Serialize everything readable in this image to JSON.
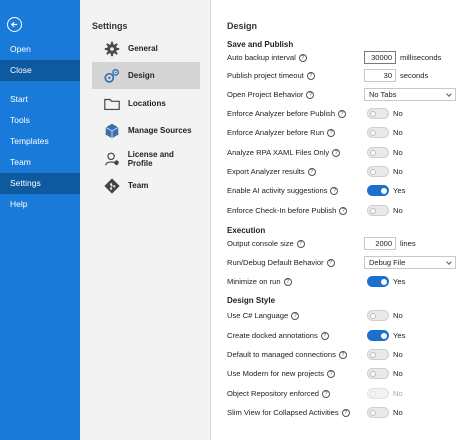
{
  "nav": {
    "items": [
      {
        "label": "Open"
      },
      {
        "label": "Close"
      },
      {
        "label": "Start"
      },
      {
        "label": "Tools"
      },
      {
        "label": "Templates"
      },
      {
        "label": "Team"
      },
      {
        "label": "Settings"
      },
      {
        "label": "Help"
      }
    ],
    "active": "Settings"
  },
  "settings": {
    "heading": "Settings",
    "categories": [
      {
        "label": "General",
        "icon": "gear-icon"
      },
      {
        "label": "Design",
        "icon": "gears-icon"
      },
      {
        "label": "Locations",
        "icon": "folder-icon"
      },
      {
        "label": "Manage Sources",
        "icon": "package-icon"
      },
      {
        "label": "License and Profile",
        "icon": "user-icon"
      },
      {
        "label": "Team",
        "icon": "git-icon"
      }
    ],
    "active": "Design"
  },
  "design": {
    "title": "Design",
    "sections": {
      "save": "Save and Publish",
      "execution": "Execution",
      "style": "Design Style"
    },
    "help_glyph": "?",
    "rows": {
      "auto_backup": {
        "label": "Auto backup interval",
        "value": "30000",
        "unit": "milliseconds"
      },
      "publish_timeout": {
        "label": "Publish project timeout",
        "value": "30",
        "unit": "seconds"
      },
      "open_behavior": {
        "label": "Open Project Behavior",
        "value": "No Tabs"
      },
      "analyzer_publish": {
        "label": "Enforce Analyzer before Publish",
        "state": "No"
      },
      "analyzer_run": {
        "label": "Enforce Analyzer before Run",
        "state": "No"
      },
      "analyze_rpa": {
        "label": "Analyze RPA XAML Files Only",
        "state": "No"
      },
      "export_analyzer": {
        "label": "Export Analyzer results",
        "state": "No"
      },
      "ai_suggestions": {
        "label": "Enable AI activity suggestions",
        "state": "Yes"
      },
      "checkin": {
        "label": "Enforce Check-In before Publish",
        "state": "No"
      },
      "console_size": {
        "label": "Output console size",
        "value": "2000",
        "unit": "lines"
      },
      "run_debug": {
        "label": "Run/Debug Default Behavior",
        "value": "Debug File"
      },
      "minimize": {
        "label": "Minimize on run",
        "state": "Yes"
      },
      "csharp": {
        "label": "Use C# Language",
        "state": "No"
      },
      "docked": {
        "label": "Create docked annotations",
        "state": "Yes"
      },
      "managed": {
        "label": "Default to managed connections",
        "state": "No"
      },
      "modern": {
        "label": "Use Modern for new projects",
        "state": "No"
      },
      "object_repo": {
        "label": "Object Repository enforced",
        "state": "No"
      },
      "slim_view": {
        "label": "Slim View for Collapsed Activities",
        "state": "No"
      }
    }
  }
}
